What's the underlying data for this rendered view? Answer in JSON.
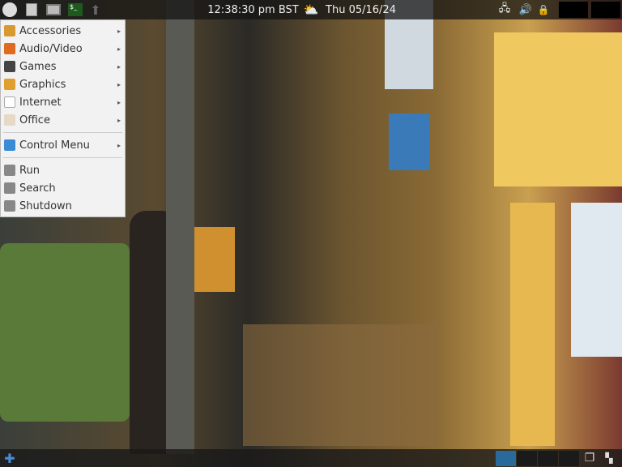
{
  "topbar": {
    "clock": "12:38:30 pm BST",
    "date": "Thu 05/16/24"
  },
  "menu": {
    "items": [
      {
        "label": "Accessories",
        "icon": "accessories-icon",
        "color": "#d89a30",
        "submenu": true
      },
      {
        "label": "Audio/Video",
        "icon": "audio-video-icon",
        "color": "#e06a20",
        "submenu": true
      },
      {
        "label": "Games",
        "icon": "games-icon",
        "color": "#444444",
        "submenu": true
      },
      {
        "label": "Graphics",
        "icon": "graphics-icon",
        "color": "#e0a030",
        "submenu": true
      },
      {
        "label": "Internet",
        "icon": "cloud-icon",
        "color": "#ffffff",
        "submenu": true
      },
      {
        "label": "Office",
        "icon": "office-icon",
        "color": "#e8d8c8",
        "submenu": true
      }
    ],
    "control": {
      "label": "Control Menu",
      "icon": "toggle-icon",
      "color": "#3a8ad8"
    },
    "actions": [
      {
        "label": "Run",
        "icon": "gears-icon"
      },
      {
        "label": "Search",
        "icon": "search-icon"
      },
      {
        "label": "Shutdown",
        "icon": "power-icon"
      }
    ]
  },
  "bottombar": {
    "active_workspace": 1,
    "workspaces": 4,
    "accent": "#2a6a9a"
  }
}
